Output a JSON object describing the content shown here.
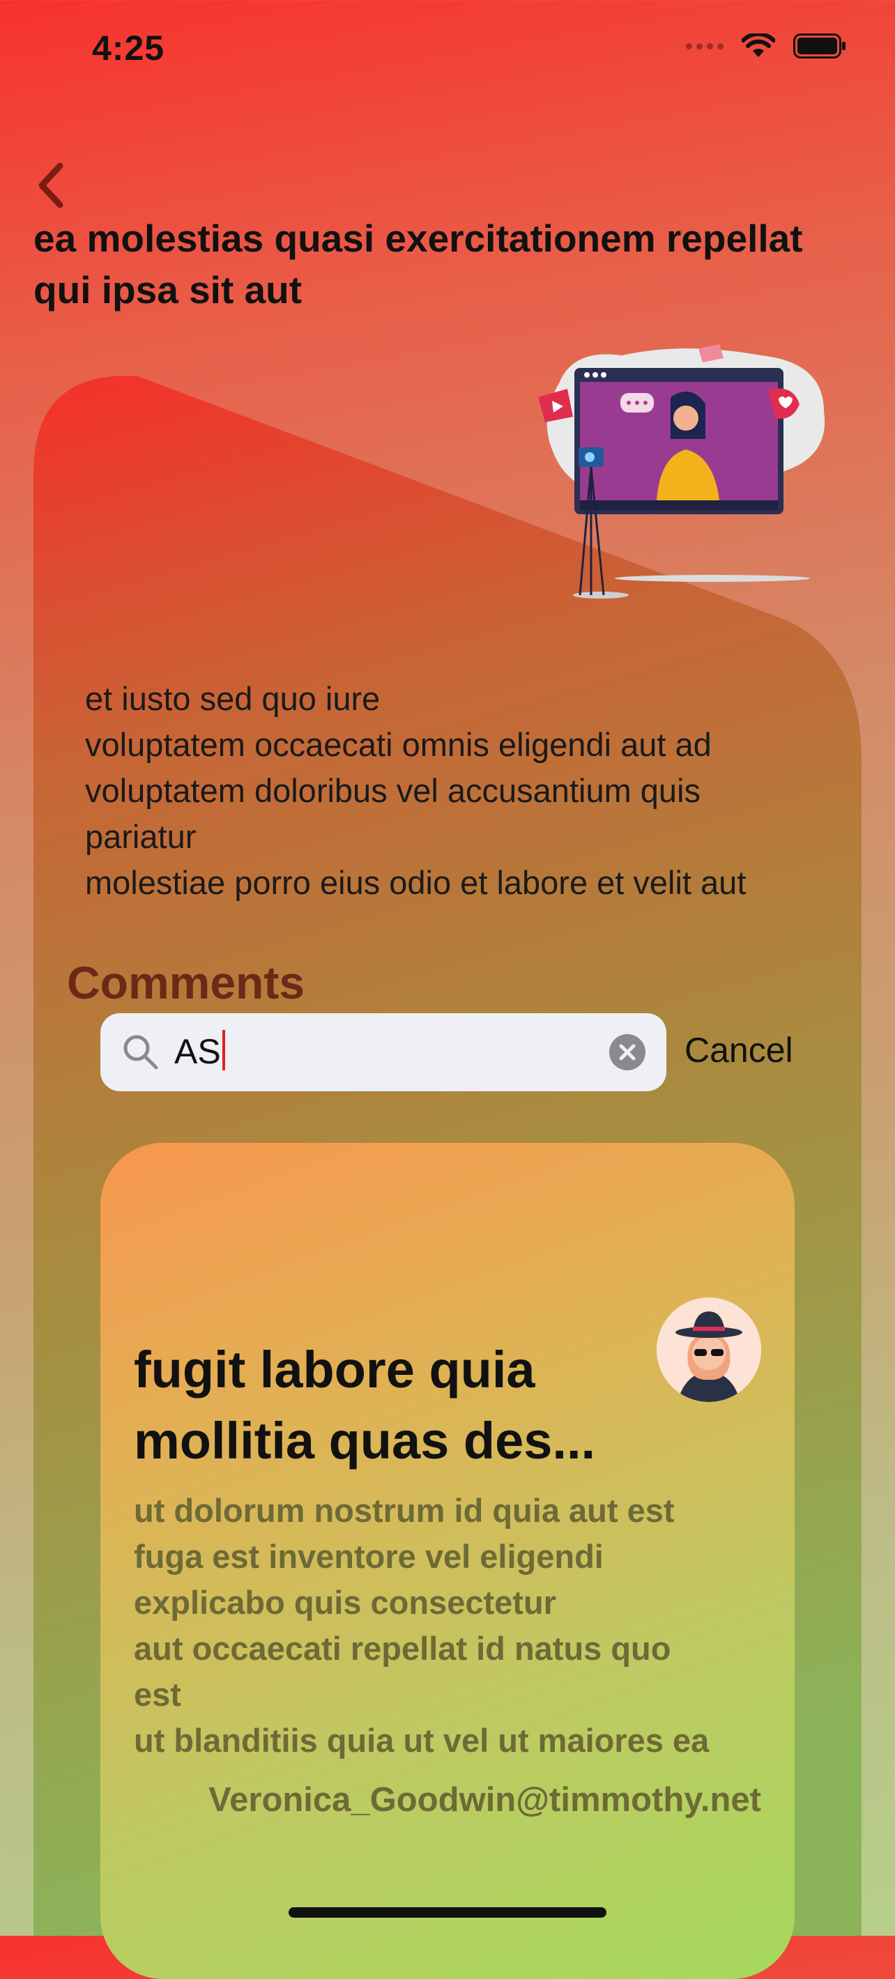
{
  "status_bar": {
    "time": "4:25"
  },
  "header": {
    "title_line1": "ea molestias quasi exercitationem repellat",
    "title_line2": "qui ipsa sit aut"
  },
  "post": {
    "description_lines": [
      "et iusto sed quo iure",
      "voluptatem occaecati omnis eligendi aut ad",
      "voluptatem doloribus vel accusantium quis",
      "pariatur",
      "molestiae porro eius odio et labore et velit aut"
    ]
  },
  "comments": {
    "heading": "Comments",
    "search": {
      "value": "AS",
      "cancel_label": "Cancel"
    },
    "items": [
      {
        "title_line1": "fugit labore quia",
        "title_line2": "mollitia quas des...",
        "body_lines": [
          "ut dolorum nostrum id quia aut est",
          "fuga est inventore vel eligendi",
          "explicabo quis consectetur",
          "aut occaecati repellat id natus quo",
          "est",
          "ut blanditiis quia ut vel ut maiores ea"
        ],
        "email": "Veronica_Goodwin@timmothy.net"
      }
    ]
  },
  "colors": {
    "accent_red": "#f7322e",
    "comments_heading": "#6b2a17",
    "card_text": "#6d6a36"
  }
}
